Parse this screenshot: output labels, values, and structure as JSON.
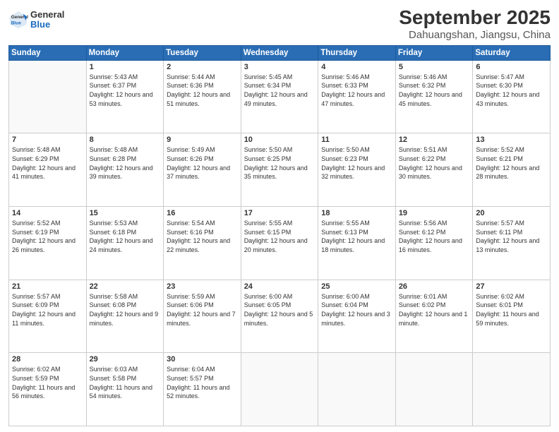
{
  "header": {
    "logo": {
      "general": "General",
      "blue": "Blue"
    },
    "title": "September 2025",
    "subtitle": "Dahuangshan, Jiangsu, China"
  },
  "calendar": {
    "days_of_week": [
      "Sunday",
      "Monday",
      "Tuesday",
      "Wednesday",
      "Thursday",
      "Friday",
      "Saturday"
    ],
    "weeks": [
      [
        {
          "day": "",
          "info": ""
        },
        {
          "day": "1",
          "info": "Sunrise: 5:43 AM\nSunset: 6:37 PM\nDaylight: 12 hours\nand 53 minutes."
        },
        {
          "day": "2",
          "info": "Sunrise: 5:44 AM\nSunset: 6:36 PM\nDaylight: 12 hours\nand 51 minutes."
        },
        {
          "day": "3",
          "info": "Sunrise: 5:45 AM\nSunset: 6:34 PM\nDaylight: 12 hours\nand 49 minutes."
        },
        {
          "day": "4",
          "info": "Sunrise: 5:46 AM\nSunset: 6:33 PM\nDaylight: 12 hours\nand 47 minutes."
        },
        {
          "day": "5",
          "info": "Sunrise: 5:46 AM\nSunset: 6:32 PM\nDaylight: 12 hours\nand 45 minutes."
        },
        {
          "day": "6",
          "info": "Sunrise: 5:47 AM\nSunset: 6:30 PM\nDaylight: 12 hours\nand 43 minutes."
        }
      ],
      [
        {
          "day": "7",
          "info": "Sunrise: 5:48 AM\nSunset: 6:29 PM\nDaylight: 12 hours\nand 41 minutes."
        },
        {
          "day": "8",
          "info": "Sunrise: 5:48 AM\nSunset: 6:28 PM\nDaylight: 12 hours\nand 39 minutes."
        },
        {
          "day": "9",
          "info": "Sunrise: 5:49 AM\nSunset: 6:26 PM\nDaylight: 12 hours\nand 37 minutes."
        },
        {
          "day": "10",
          "info": "Sunrise: 5:50 AM\nSunset: 6:25 PM\nDaylight: 12 hours\nand 35 minutes."
        },
        {
          "day": "11",
          "info": "Sunrise: 5:50 AM\nSunset: 6:23 PM\nDaylight: 12 hours\nand 32 minutes."
        },
        {
          "day": "12",
          "info": "Sunrise: 5:51 AM\nSunset: 6:22 PM\nDaylight: 12 hours\nand 30 minutes."
        },
        {
          "day": "13",
          "info": "Sunrise: 5:52 AM\nSunset: 6:21 PM\nDaylight: 12 hours\nand 28 minutes."
        }
      ],
      [
        {
          "day": "14",
          "info": "Sunrise: 5:52 AM\nSunset: 6:19 PM\nDaylight: 12 hours\nand 26 minutes."
        },
        {
          "day": "15",
          "info": "Sunrise: 5:53 AM\nSunset: 6:18 PM\nDaylight: 12 hours\nand 24 minutes."
        },
        {
          "day": "16",
          "info": "Sunrise: 5:54 AM\nSunset: 6:16 PM\nDaylight: 12 hours\nand 22 minutes."
        },
        {
          "day": "17",
          "info": "Sunrise: 5:55 AM\nSunset: 6:15 PM\nDaylight: 12 hours\nand 20 minutes."
        },
        {
          "day": "18",
          "info": "Sunrise: 5:55 AM\nSunset: 6:13 PM\nDaylight: 12 hours\nand 18 minutes."
        },
        {
          "day": "19",
          "info": "Sunrise: 5:56 AM\nSunset: 6:12 PM\nDaylight: 12 hours\nand 16 minutes."
        },
        {
          "day": "20",
          "info": "Sunrise: 5:57 AM\nSunset: 6:11 PM\nDaylight: 12 hours\nand 13 minutes."
        }
      ],
      [
        {
          "day": "21",
          "info": "Sunrise: 5:57 AM\nSunset: 6:09 PM\nDaylight: 12 hours\nand 11 minutes."
        },
        {
          "day": "22",
          "info": "Sunrise: 5:58 AM\nSunset: 6:08 PM\nDaylight: 12 hours\nand 9 minutes."
        },
        {
          "day": "23",
          "info": "Sunrise: 5:59 AM\nSunset: 6:06 PM\nDaylight: 12 hours\nand 7 minutes."
        },
        {
          "day": "24",
          "info": "Sunrise: 6:00 AM\nSunset: 6:05 PM\nDaylight: 12 hours\nand 5 minutes."
        },
        {
          "day": "25",
          "info": "Sunrise: 6:00 AM\nSunset: 6:04 PM\nDaylight: 12 hours\nand 3 minutes."
        },
        {
          "day": "26",
          "info": "Sunrise: 6:01 AM\nSunset: 6:02 PM\nDaylight: 12 hours\nand 1 minute."
        },
        {
          "day": "27",
          "info": "Sunrise: 6:02 AM\nSunset: 6:01 PM\nDaylight: 11 hours\nand 59 minutes."
        }
      ],
      [
        {
          "day": "28",
          "info": "Sunrise: 6:02 AM\nSunset: 5:59 PM\nDaylight: 11 hours\nand 56 minutes."
        },
        {
          "day": "29",
          "info": "Sunrise: 6:03 AM\nSunset: 5:58 PM\nDaylight: 11 hours\nand 54 minutes."
        },
        {
          "day": "30",
          "info": "Sunrise: 6:04 AM\nSunset: 5:57 PM\nDaylight: 11 hours\nand 52 minutes."
        },
        {
          "day": "",
          "info": ""
        },
        {
          "day": "",
          "info": ""
        },
        {
          "day": "",
          "info": ""
        },
        {
          "day": "",
          "info": ""
        }
      ]
    ]
  }
}
